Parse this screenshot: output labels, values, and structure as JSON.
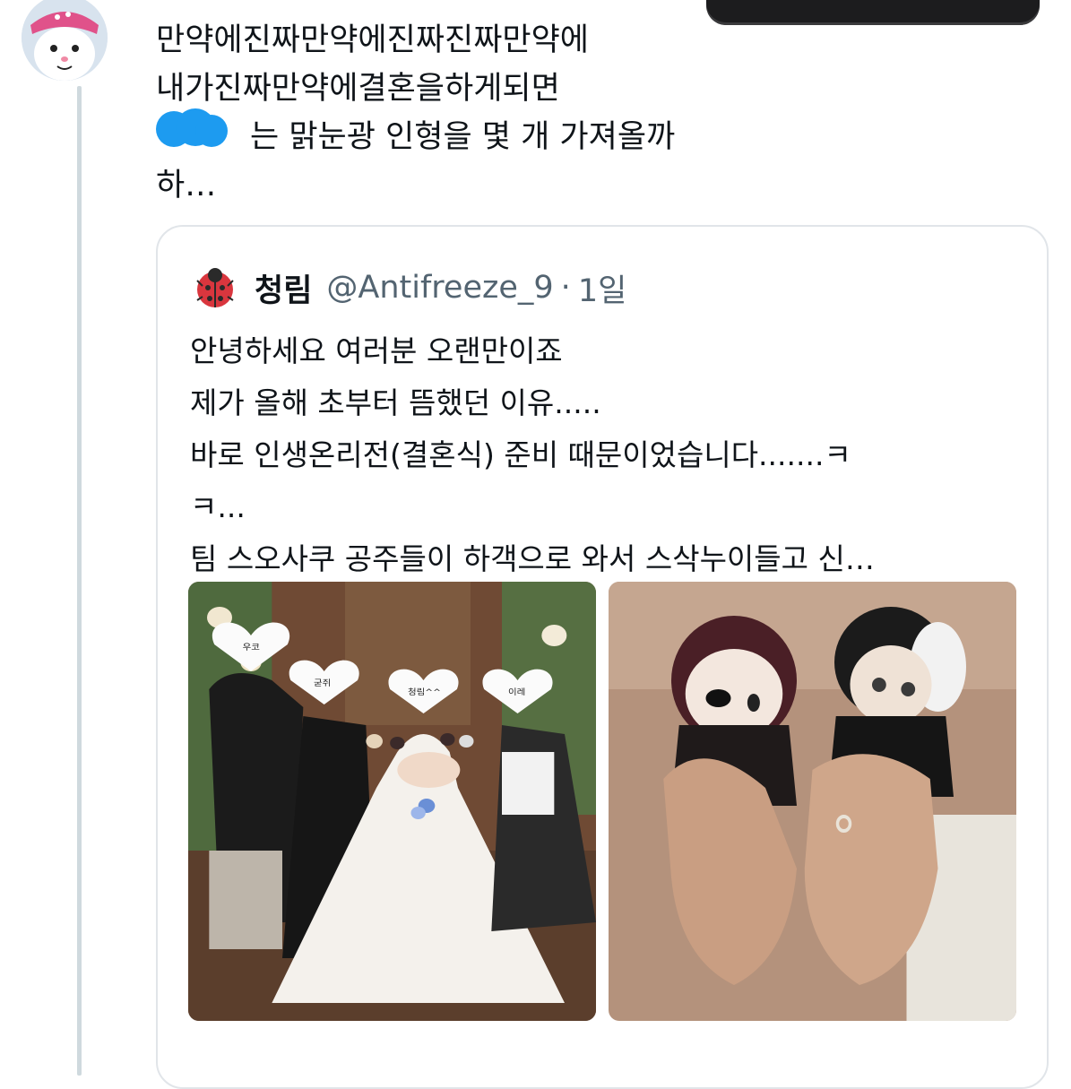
{
  "tweet": {
    "text": "만약에진짜만약에진짜진짜만약에\n내가진짜만약에결혼을하게되면\n　　　는 맑눈광 인형을 몇 개 가져올까\n하…"
  },
  "quoted_tweet": {
    "display_name": "청림",
    "handle": "@Antifreeze_9",
    "separator": "·",
    "time": "1일",
    "text": "안녕하세요 여러분 오랜만이죠\n제가 올해 초부터 뜸했던 이유.....\n바로 인생온리전(결혼식) 준비 때문이었습니다.......ㅋ\nㅋ...\n팀 스오사쿠 공주들이 하객으로 와서 스삭누이들고 신…",
    "photo_labels": [
      "우코",
      "굳쥐",
      "청림^^",
      "이레"
    ]
  },
  "colors": {
    "thread_line": "#cfd9de",
    "redaction_blue": "#1d9bf0",
    "secondary_text": "#536471"
  }
}
